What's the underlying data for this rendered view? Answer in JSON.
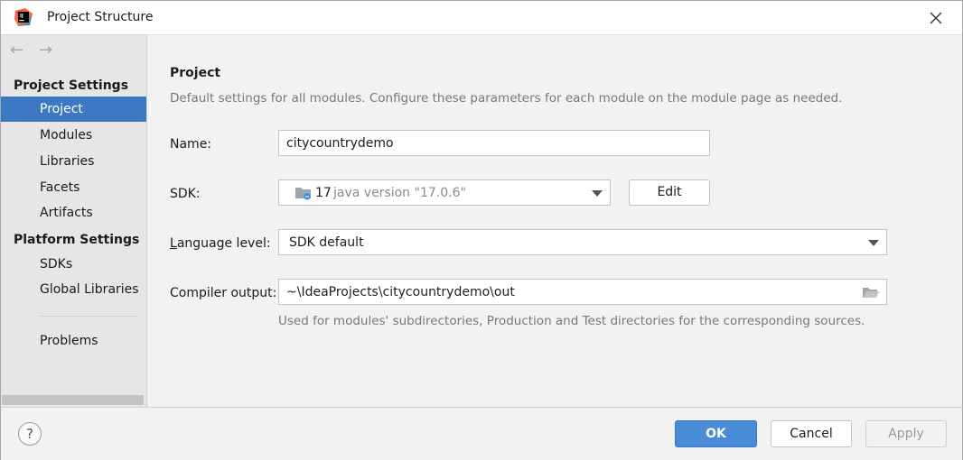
{
  "window": {
    "title": "Project Structure"
  },
  "sidebar": {
    "project_settings_title": "Project Settings",
    "project_items": [
      {
        "label": "Project",
        "selected": true
      },
      {
        "label": "Modules"
      },
      {
        "label": "Libraries"
      },
      {
        "label": "Facets"
      },
      {
        "label": "Artifacts"
      }
    ],
    "platform_settings_title": "Platform Settings",
    "platform_items": [
      {
        "label": "SDKs"
      },
      {
        "label": "Global Libraries"
      }
    ],
    "problems_label": "Problems"
  },
  "main": {
    "heading": "Project",
    "description": "Default settings for all modules. Configure these parameters for each module on the module page as needed.",
    "name_label": "Name:",
    "name_value": "citycountrydemo",
    "sdk_label": "SDK:",
    "sdk_version": "17",
    "sdk_detail": "java version \"17.0.6\"",
    "edit_label": "Edit",
    "language_level_label_prefix": "L",
    "language_level_label_rest": "anguage level:",
    "language_level_value": "SDK default",
    "compiler_output_label": "Compiler output:",
    "compiler_output_value": "~\\IdeaProjects\\citycountrydemo\\out",
    "compiler_output_hint": "Used for modules' subdirectories, Production and Test directories for the corresponding sources."
  },
  "footer": {
    "help_label": "?",
    "ok_label": "OK",
    "cancel_label": "Cancel",
    "apply_label": "Apply"
  },
  "colors": {
    "accent": "#3d78c2",
    "ok_button": "#4a8bd6",
    "sidebar_bg": "#e6e6e6",
    "hint_text": "#787878"
  }
}
